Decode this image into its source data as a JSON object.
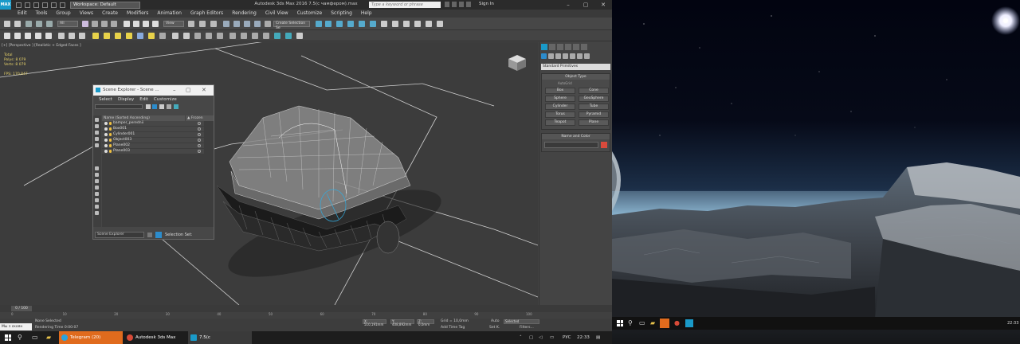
{
  "app": {
    "logo_text": "MAX",
    "workspace": "Workspace: Default",
    "window_title": "Autodesk 3ds Max 2016    7.5(с чамфером).max",
    "search_placeholder": "Type a keyword or phrase",
    "sign_in": "Sign In"
  },
  "menu": [
    "Edit",
    "Tools",
    "Group",
    "Views",
    "Create",
    "Modifiers",
    "Animation",
    "Graph Editors",
    "Rendering",
    "Civil View",
    "Customize",
    "Scripting",
    "Help"
  ],
  "toolbar": {
    "selection_filter": "All",
    "ref_coord": "View",
    "named_selection": "Create Selection Se"
  },
  "viewport": {
    "label": "[+] [Perspective ] [Realistic + Edged Faces ]",
    "stats": [
      {
        "label": "Total",
        "value": ""
      },
      {
        "label": "Polys:",
        "value": "8 079"
      },
      {
        "label": "Verts:",
        "value": "8 079"
      },
      {
        "label": "FPS:",
        "value": "170,847"
      }
    ]
  },
  "scene_explorer": {
    "title": "Scene Explorer - Scene ...",
    "menu": [
      "Select",
      "Display",
      "Edit",
      "Customize"
    ],
    "col_name": "Name (Sorted Ascending)",
    "col_frozen": "▲ Frozen",
    "rows": [
      "bamper_perednii",
      "Box001",
      "Cylinder001",
      "Object003",
      "Plane002",
      "Plane003"
    ],
    "footer_dropdown": "Scene Explorer",
    "selection_set_label": "Selection Set:"
  },
  "command_panel": {
    "category": "Standard Primitives",
    "object_type_header": "Object Type",
    "autogrid": "AutoGrid",
    "primitives": [
      "Box",
      "Cone",
      "Sphere",
      "GeoSphere",
      "Cylinder",
      "Tube",
      "Torus",
      "Pyramid",
      "Teapot",
      "Plane"
    ],
    "name_color_header": "Name and Color",
    "color": "#d94a3c"
  },
  "timeline": {
    "slider": "0 / 100",
    "ticks": [
      "0",
      "5",
      "10",
      "15",
      "20",
      "25",
      "30",
      "35",
      "40",
      "45",
      "50",
      "55",
      "60",
      "65",
      "70",
      "75",
      "80",
      "85",
      "90",
      "95",
      "100"
    ]
  },
  "status": {
    "maxscript": "Мы з скоян",
    "selection": "None Selected",
    "rendering_time": "Rendering Time  0:00:07",
    "x": "X: 510,191mm",
    "y": "Y: 408,892mm",
    "z": "Z: 0,0mm",
    "grid": "Grid = 10,0mm",
    "add_time_tag": "Add Time Tag",
    "auto": "Auto",
    "selected": "Selected",
    "set_k": "Set K.",
    "filters": "Filters..."
  },
  "taskbar": {
    "apps": [
      "Telegram (20)",
      "Autodesk 3ds Max 20...",
      "7.5(с чамфером).max..."
    ],
    "lang": "РУС",
    "clock": "22:33"
  },
  "desktop_taskbar": {
    "clock": "22:33"
  }
}
